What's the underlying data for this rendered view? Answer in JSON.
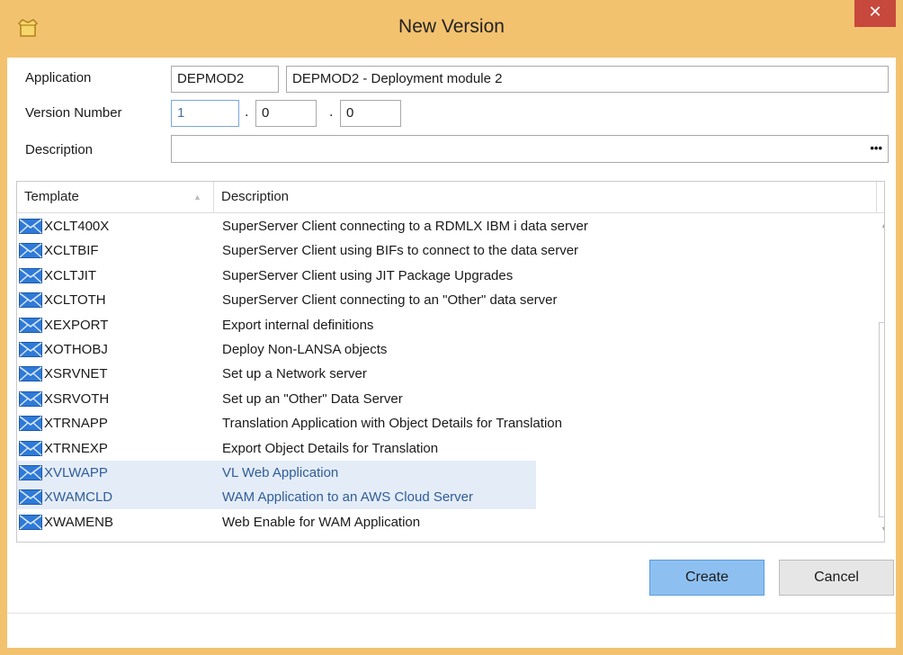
{
  "window": {
    "title": "New Version",
    "close_glyph": "✕",
    "app_icon": "lansa-app-icon"
  },
  "form": {
    "application_label": "Application",
    "application_code": "DEPMOD2",
    "application_name": "DEPMOD2 - Deployment module 2",
    "version_label": "Version Number",
    "version_major": "1",
    "version_minor": "0",
    "version_patch": "0",
    "version_separator": ".",
    "description_label": "Description",
    "description_value": "",
    "description_ellipsis": "•••"
  },
  "grid": {
    "columns": [
      "Template",
      "Description"
    ],
    "sort_glyph": "▲",
    "rows": [
      {
        "code": "XCLT400X",
        "description": "SuperServer Client connecting to a RDMLX IBM i data server",
        "selected": false
      },
      {
        "code": "XCLTBIF",
        "description": "SuperServer Client using BIFs to connect to the data server",
        "selected": false
      },
      {
        "code": "XCLTJIT",
        "description": "SuperServer Client using JIT Package Upgrades",
        "selected": false
      },
      {
        "code": "XCLTOTH",
        "description": "SuperServer Client connecting to an \"Other\" data server",
        "selected": false
      },
      {
        "code": "XEXPORT",
        "description": "Export internal definitions",
        "selected": false
      },
      {
        "code": "XOTHOBJ",
        "description": "Deploy Non-LANSA objects",
        "selected": false
      },
      {
        "code": "XSRVNET",
        "description": "Set up a Network server",
        "selected": false
      },
      {
        "code": "XSRVOTH",
        "description": "Set up an \"Other\" Data Server",
        "selected": false
      },
      {
        "code": "XTRNAPP",
        "description": "Translation Application with Object Details for Translation",
        "selected": false
      },
      {
        "code": "XTRNEXP",
        "description": "Export Object Details for Translation",
        "selected": false
      },
      {
        "code": "XVLWAPP",
        "description": "VL Web Application",
        "selected": true
      },
      {
        "code": "XWAMCLD",
        "description": "WAM Application to an AWS Cloud Server",
        "selected": true
      },
      {
        "code": "XWAMENB",
        "description": "Web Enable for WAM Application",
        "selected": false
      }
    ],
    "row_icon": "template-envelope-icon",
    "scroll_up_glyph": "▲",
    "scroll_down_glyph": "▼"
  },
  "buttons": {
    "create_label": "Create",
    "cancel_label": "Cancel"
  },
  "colors": {
    "titlebar": "#f3c26f",
    "close": "#c7483c",
    "selection": "#e4ecf7",
    "primary_button": "#8dc0f0"
  }
}
